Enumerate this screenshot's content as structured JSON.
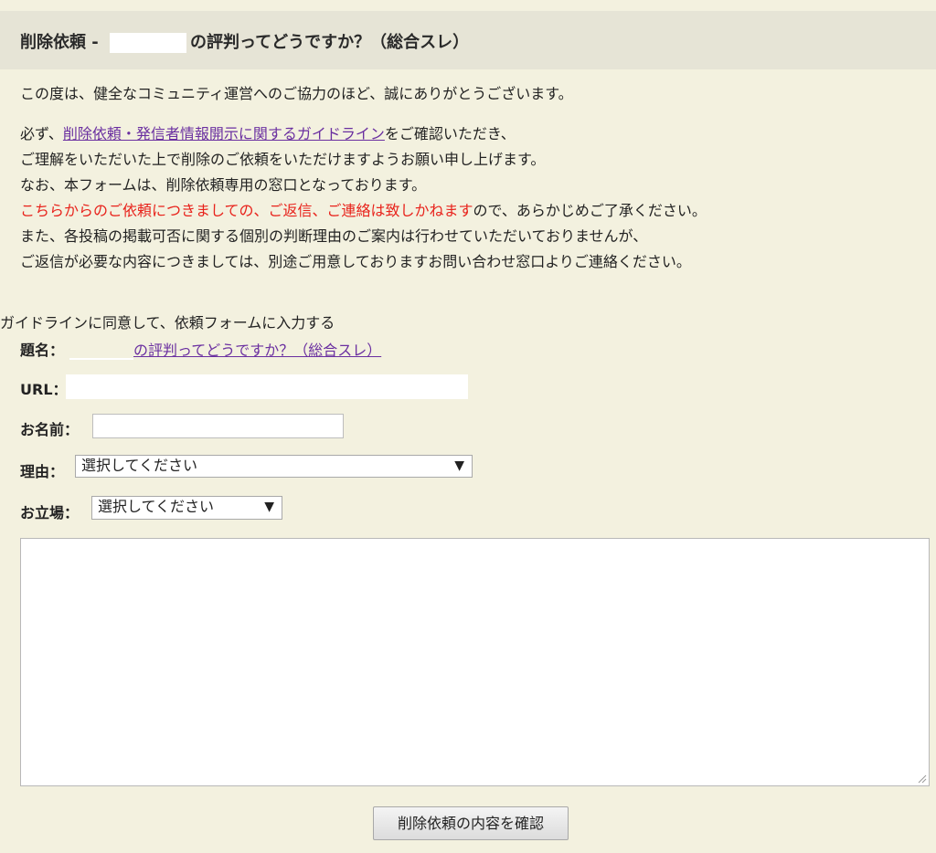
{
  "header": {
    "title_prefix": "削除依頼 -",
    "title_suffix": "の評判ってどうですか？（総合スレ）"
  },
  "intro": {
    "line1": "この度は、健全なコミュニティ運営へのご協力のほど、誠にありがとうございます。",
    "line2_prefix": "必ず、",
    "guideline_link": "削除依頼・発信者情報開示に関するガイドライン",
    "line2_suffix": "をご確認いただき、",
    "line3": "ご理解をいただいた上で削除のご依頼をいただけますようお願い申し上げます。",
    "line4": "なお、本フォームは、削除依頼専用の窓口となっております。",
    "line5_red": "こちらからのご依頼につきましての、ご返信、ご連絡は致しかねます",
    "line5_suffix": "ので、あらかじめご了承ください。",
    "line6": "また、各投稿の掲載可否に関する個別の判断理由のご案内は行わせていただいておりませんが、",
    "line7": "ご返信が必要な内容につきましては、別途ご用意しておりますお問い合わせ窓口よりご連絡ください。"
  },
  "form": {
    "agree_text": "ガイドラインに同意して、依頼フォームに入力する",
    "subject_label": "題名：",
    "subject_value": "の評判ってどうですか？（総合スレ）",
    "url_label": "URL：",
    "name_label": "お名前：",
    "name_value": "",
    "reason_label": "理由：",
    "reason_selected": "選択してください",
    "position_label": "お立場：",
    "position_selected": "選択してください",
    "message_value": "",
    "submit_label": "削除依頼の内容を確認"
  },
  "icons": {
    "dropdown": "chevron-down-icon",
    "resize": "resize-grip-icon"
  }
}
